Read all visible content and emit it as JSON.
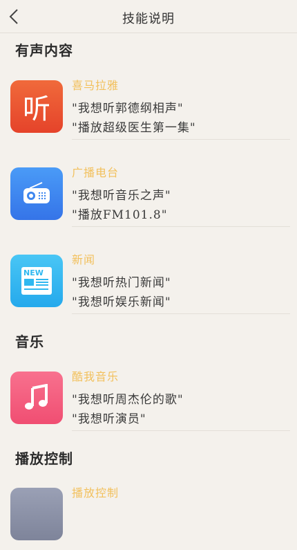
{
  "header": {
    "title": "技能说明",
    "back_icon": "chevron-left-icon"
  },
  "sections": [
    {
      "title": "有声内容",
      "items": [
        {
          "name": "喜马拉雅",
          "icon": "ximalaya-listen-icon",
          "icon_text": "听",
          "color": "#e9522c",
          "examples": [
            "\"我想听郭德纲相声\"",
            "\"播放超级医生第一集\""
          ]
        },
        {
          "name": "广播电台",
          "icon": "radio-icon",
          "color": "#3d86ef",
          "examples": [
            "\"我想听音乐之声\"",
            "\"播放FM101.8\""
          ]
        },
        {
          "name": "新闻",
          "icon": "newspaper-icon",
          "icon_text": "NEW",
          "color": "#2fb8f0",
          "examples": [
            "\"我想听热门新闻\"",
            "\"我想听娱乐新闻\""
          ]
        }
      ]
    },
    {
      "title": "音乐",
      "items": [
        {
          "name": "酷我音乐",
          "icon": "music-note-icon",
          "color": "#f45e7f",
          "examples": [
            "\"我想听周杰伦的歌\"",
            "\"我想听演员\""
          ]
        }
      ]
    },
    {
      "title": "播放控制",
      "items": [
        {
          "name": "播放控制",
          "icon": "playback-control-icon",
          "color": "#8a8fa6",
          "examples": []
        }
      ]
    }
  ]
}
